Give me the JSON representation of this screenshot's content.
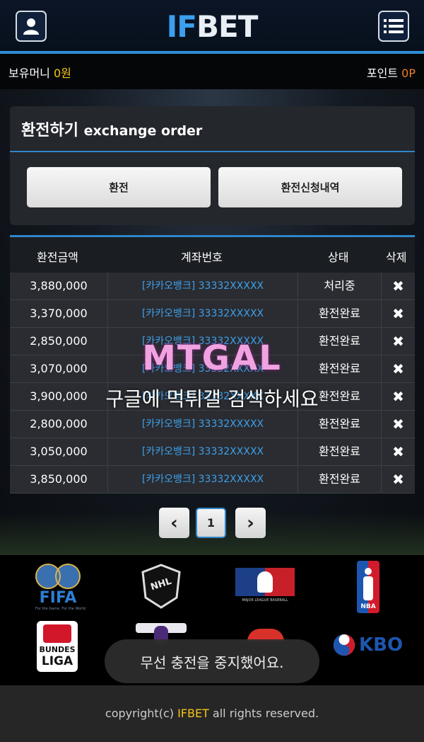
{
  "header": {
    "logo_if": "IF",
    "logo_bet": "BET",
    "user_icon": "user-icon",
    "menu_icon": "menu-icon"
  },
  "balance": {
    "money_label": "보유머니",
    "money_value": "0원",
    "point_label": "포인트",
    "point_value": "0P"
  },
  "exchange": {
    "title_kr": "환전하기",
    "title_en": "exchange order",
    "btn_exchange": "환전",
    "btn_history": "환전신청내역"
  },
  "table": {
    "headers": [
      "환전금액",
      "계좌번호",
      "상태",
      "삭제"
    ],
    "rows": [
      {
        "amount": "3,880,000",
        "account": "[카카오뱅크] 33332XXXXX",
        "status": "처리중",
        "delete": "✖"
      },
      {
        "amount": "3,370,000",
        "account": "[카카오뱅크] 33332XXXXX",
        "status": "환전완료",
        "delete": "✖"
      },
      {
        "amount": "2,850,000",
        "account": "[카카오뱅크] 33332XXXXX",
        "status": "환전완료",
        "delete": "✖"
      },
      {
        "amount": "3,070,000",
        "account": "[카카오뱅크] 33332XXXXX",
        "status": "환전완료",
        "delete": "✖"
      },
      {
        "amount": "3,900,000",
        "account": "[카카오뱅크] 33332XXXXX",
        "status": "환전완료",
        "delete": "✖"
      },
      {
        "amount": "2,800,000",
        "account": "[카카오뱅크] 33332XXXXX",
        "status": "환전완료",
        "delete": "✖"
      },
      {
        "amount": "3,050,000",
        "account": "[카카오뱅크] 33332XXXXX",
        "status": "환전완료",
        "delete": "✖"
      },
      {
        "amount": "3,850,000",
        "account": "[카카오뱅크] 33332XXXXX",
        "status": "환전완료",
        "delete": "✖"
      }
    ]
  },
  "pagination": {
    "prev": "‹",
    "current": "1",
    "next": "›"
  },
  "partners": {
    "fifa": "FIFA",
    "fifa_tag": "For the Game. For the World.",
    "nhl": "NHL",
    "mlb": "MAJOR LEAGUE BASEBALL",
    "nba": "NBA",
    "bundes_1": "BUNDES",
    "bundes_2": "LIGA",
    "kbo": "KBO"
  },
  "watermark": {
    "logo": "MTGAL",
    "text": "구글에 먹튀갤 검색하세요"
  },
  "toast": "무선 충전을 중지했어요.",
  "footer": {
    "prefix": "copyright(c) ",
    "brand": "IFBET",
    "suffix": " all rights reserved."
  },
  "colors": {
    "accent": "#2f86c9",
    "highlight": "#f4c518",
    "link": "#3ea0ea"
  }
}
